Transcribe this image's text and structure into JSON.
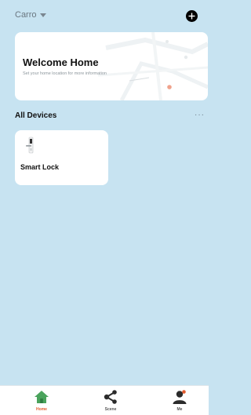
{
  "header": {
    "home_name": "Carro",
    "add_icon": "plus-circle-icon"
  },
  "welcome": {
    "title": "Welcome Home",
    "subtitle": "Set your home location for more information"
  },
  "devices_section": {
    "title": "All Devices",
    "more_label": "···"
  },
  "devices": [
    {
      "name": "Smart Lock",
      "icon": "smart-lock-icon"
    }
  ],
  "tabbar": {
    "tabs": [
      {
        "label": "Home",
        "icon": "home-icon",
        "active": true
      },
      {
        "label": "Scene",
        "icon": "share-nodes-icon",
        "active": false
      },
      {
        "label": "Me",
        "icon": "user-icon",
        "active": false
      }
    ]
  },
  "colors": {
    "background": "#c7e3f1",
    "accent": "#e35b2e",
    "home_icon_green": "#4aa35c"
  }
}
